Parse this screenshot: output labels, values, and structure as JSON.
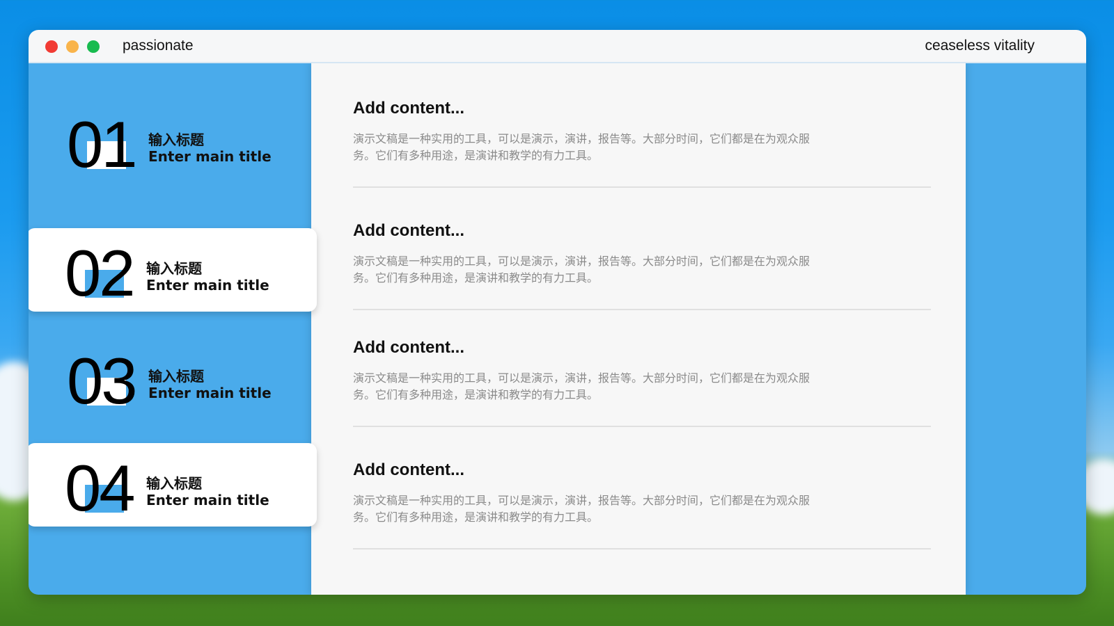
{
  "window": {
    "app_title": "passionate",
    "right_title": "ceaseless vitality",
    "traffic_lights": {
      "close": "#f13b34",
      "minimize": "#f9b44b",
      "zoom": "#18bb4f"
    }
  },
  "colors": {
    "accent": "#4aabeb",
    "panel": "#f7f7f7"
  },
  "nav": {
    "items": [
      {
        "num": "01",
        "title_cn": "输入标题",
        "title_en": "Enter main title",
        "active": false
      },
      {
        "num": "02",
        "title_cn": "输入标题",
        "title_en": "Enter main title",
        "active": true
      },
      {
        "num": "03",
        "title_cn": "输入标题",
        "title_en": "Enter main title",
        "active": false
      },
      {
        "num": "04",
        "title_cn": "输入标题",
        "title_en": "Enter main title",
        "active": true
      }
    ]
  },
  "entries": [
    {
      "title": "Add content...",
      "body": "演示文稿是一种实用的工具，可以是演示，演讲，报告等。大部分时间，它们都是在为观众服务。它们有多种用途，是演讲和教学的有力工具。"
    },
    {
      "title": "Add content...",
      "body": "演示文稿是一种实用的工具，可以是演示，演讲，报告等。大部分时间，它们都是在为观众服务。它们有多种用途，是演讲和教学的有力工具。"
    },
    {
      "title": "Add content...",
      "body": "演示文稿是一种实用的工具，可以是演示，演讲，报告等。大部分时间，它们都是在为观众服务。它们有多种用途，是演讲和教学的有力工具。"
    },
    {
      "title": "Add content...",
      "body": "演示文稿是一种实用的工具，可以是演示，演讲，报告等。大部分时间，它们都是在为观众服务。它们有多种用途，是演讲和教学的有力工具。"
    }
  ]
}
